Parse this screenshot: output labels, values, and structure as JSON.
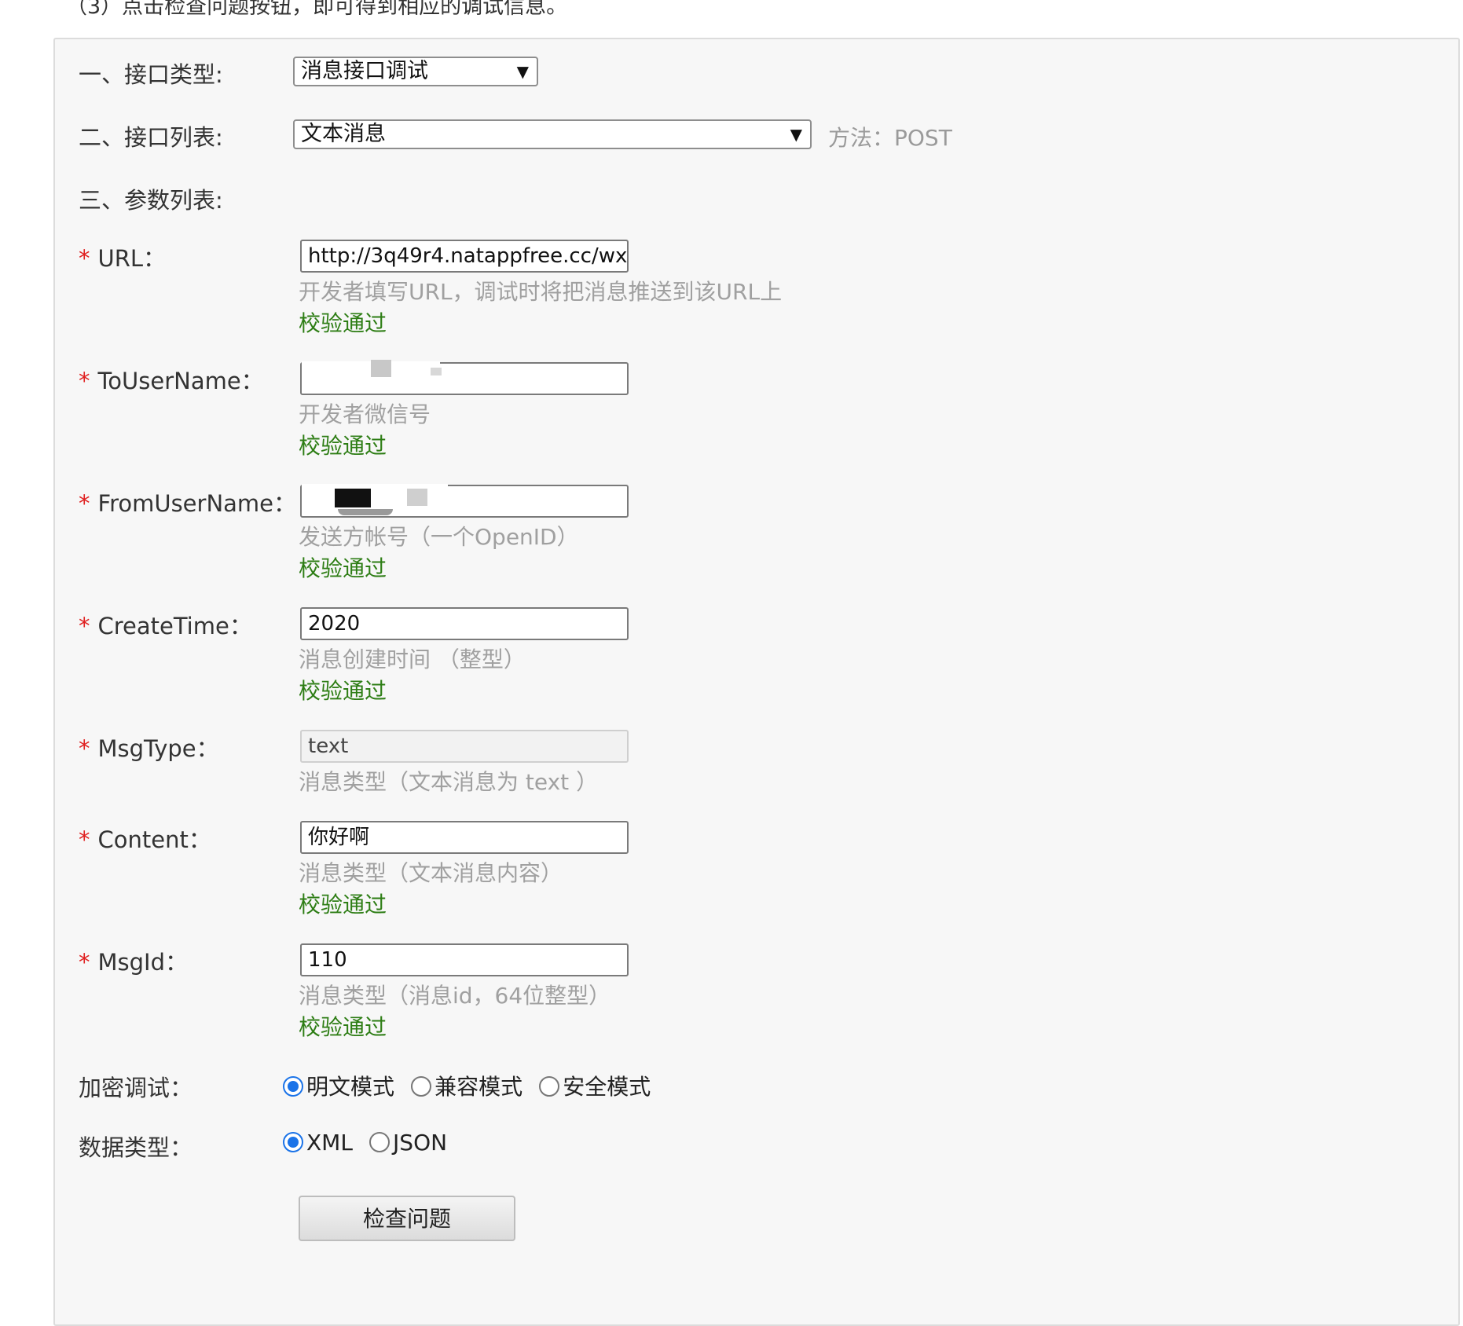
{
  "intro_text": "（3）点击检查问题按钮，即可得到相应的调试信息。",
  "section1": {
    "label": "一、接口类型:",
    "select_value": "消息接口调试"
  },
  "section2": {
    "label": "二、接口列表:",
    "select_value": "文本消息",
    "method": "方法：POST"
  },
  "section3": {
    "label": "三、参数列表:"
  },
  "required_mark": "*",
  "fields": [
    {
      "label": "URL：",
      "value": "http://3q49r4.natappfree.cc/wx",
      "hint": "开发者填写URL，调试时将把消息推送到该URL上",
      "status": "校验通过"
    },
    {
      "label": "ToUserName：",
      "value": "",
      "hint": "开发者微信号",
      "status": "校验通过"
    },
    {
      "label": "FromUserName：",
      "value": "",
      "hint": "发送方帐号（一个OpenID）",
      "status": "校验通过"
    },
    {
      "label": "CreateTime：",
      "value": "2020",
      "hint": "消息创建时间 （整型）",
      "status": "校验通过"
    },
    {
      "label": "MsgType：",
      "value": "text",
      "hint": "消息类型（文本消息为 text ）",
      "status": ""
    },
    {
      "label": "Content：",
      "value": "你好啊",
      "hint": "消息类型（文本消息内容）",
      "status": "校验通过"
    },
    {
      "label": "MsgId：",
      "value": "110",
      "hint": "消息类型（消息id，64位整型）",
      "status": "校验通过"
    }
  ],
  "encryption": {
    "label": "加密调试：",
    "options": [
      "明文模式",
      "兼容模式",
      "安全模式"
    ],
    "selected": "明文模式"
  },
  "data_type": {
    "label": "数据类型：",
    "options": [
      "XML",
      "JSON"
    ],
    "selected": "XML"
  },
  "check_button": "检查问题",
  "colors": {
    "required": "#e02020",
    "valid": "#2d7d14",
    "hint": "#a0a0a0",
    "radio_selected": "#1a73e8"
  }
}
